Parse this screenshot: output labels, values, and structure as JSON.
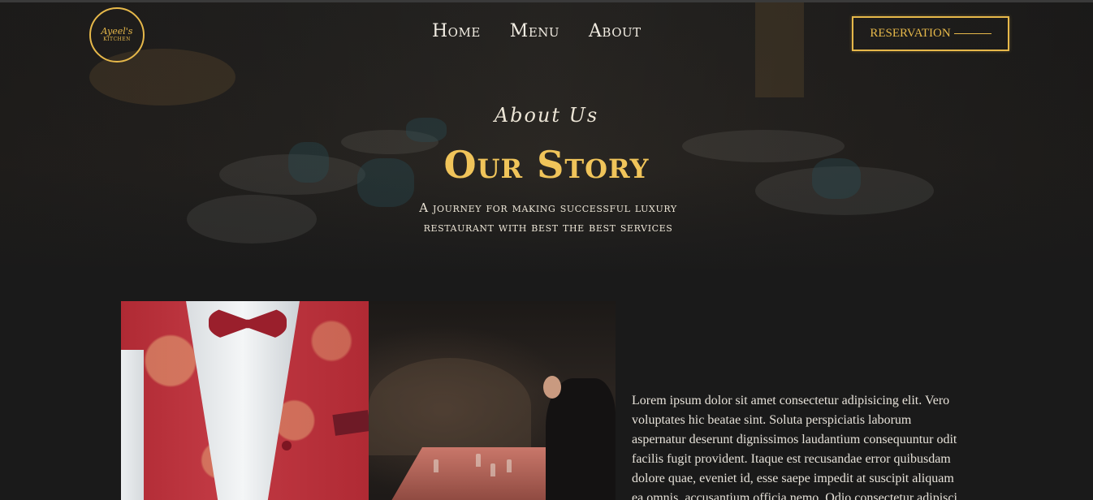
{
  "header": {
    "logo": {
      "line1": "Ayeel's",
      "line2": "KITCHEN"
    },
    "nav": [
      {
        "label": "Home"
      },
      {
        "label": "Menu"
      },
      {
        "label": "About"
      }
    ],
    "reservation_label": "RESERVATION"
  },
  "hero": {
    "kicker": "About Us",
    "title": "Our Story",
    "subtitle": "A journey for making successful luxury restaurant with best the best services"
  },
  "content": {
    "images": [
      {
        "name": "waiter-vest-image"
      },
      {
        "name": "dining-table-image"
      }
    ],
    "paragraph": "Lorem ipsum dolor sit amet consectetur adipisicing elit. Vero voluptates hic beatae sint. Soluta perspiciatis laborum aspernatur deserunt dignissimos laudantium consequuntur odit facilis fugit provident. Itaque est recusandae error quibusdam dolore quae, eveniet id, esse saepe impedit at suscipit aliquam ea omnis, accusantium officia nemo. Odio consectetur adipisci"
  },
  "colors": {
    "accent": "#e6b84a",
    "background": "#1a1a1a",
    "text": "#ece5d6"
  }
}
